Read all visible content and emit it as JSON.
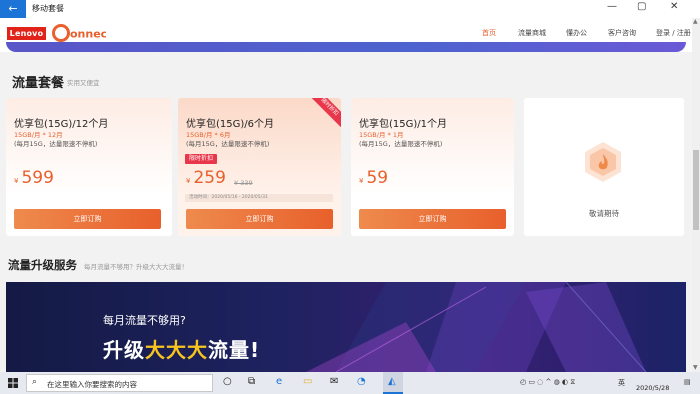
{
  "window": {
    "back": "←",
    "title": "移动套餐",
    "min": "—",
    "max": "▢",
    "close": "✕"
  },
  "header": {
    "brand_lenovo": "Lenovo",
    "brand_connect": "Connect",
    "nav": [
      "首页",
      "流量商城",
      "懂办公",
      "客户咨询",
      "登录 / 注册"
    ],
    "active_nav": "首页"
  },
  "packages": {
    "title": "流量套餐",
    "subtitle": "实用又便宜",
    "cards": [
      {
        "name": "优享包(15G)/12个月",
        "spec": "15GB/月 * 12月",
        "desc": "(每月15G，达量限速不停机)",
        "currency": "¥",
        "price": "599",
        "button": "立即订购"
      },
      {
        "name": "优享包(15G)/6个月",
        "spec": "15GB/月 * 6月",
        "desc": "(每月15G，达量限速不停机)",
        "tag": "限时折扣",
        "currency": "¥",
        "price": "259",
        "old_price": "¥ 339",
        "time": "活动时间：2020/05/16 - 2020/05/31",
        "ribbon": "限时折扣",
        "button": "立即订购"
      },
      {
        "name": "优享包(15G)/1个月",
        "spec": "15GB/月 * 1月",
        "desc": "(每月15G，达量限速不停机)",
        "currency": "¥",
        "price": "59",
        "button": "立即订购"
      },
      {
        "coming": "敬请期待"
      }
    ]
  },
  "upgrade": {
    "title": "流量升级服务",
    "subtitle": "每月流量不够用？升级大大大流量！",
    "promo_question": "每月流量不够用?",
    "promo_prefix": "升级",
    "promo_highlight": "大大大",
    "promo_suffix": "流量!"
  },
  "taskbar": {
    "search_placeholder": "在这里输入你要搜索的内容",
    "ime": "英",
    "date": "2020/5/28"
  },
  "colors": {
    "accent": "#e8602c",
    "lenovo_red": "#e2231a",
    "titlebar_blue": "#1b74d6",
    "highlight_yellow": "#f7c51e"
  }
}
